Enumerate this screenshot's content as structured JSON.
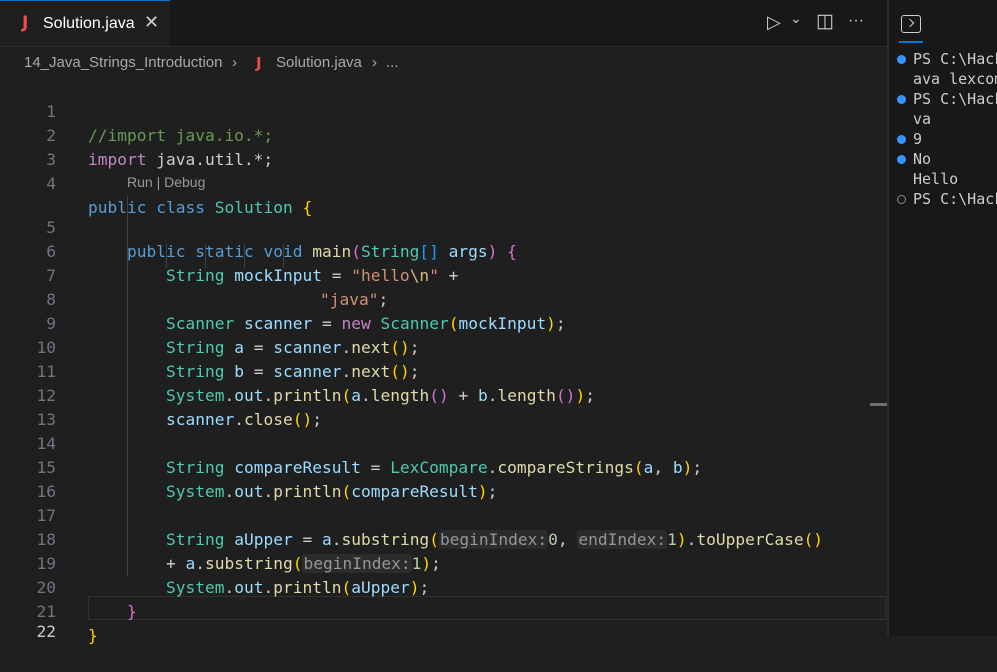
{
  "tab": {
    "title": "Solution.java",
    "close_glyph": "✕",
    "icon": "java-icon"
  },
  "actions": {
    "run_glyph": "▷",
    "chevron_glyph": "⌄",
    "split_glyph": "◫",
    "more_glyph": "···"
  },
  "breadcrumb": {
    "folder": "14_Java_Strings_Introduction",
    "file": "Solution.java",
    "more": "...",
    "sep": "›",
    "icon_glyph": "J"
  },
  "codelens": "Run | Debug",
  "code": {
    "1": {
      "num": "1",
      "t1": "//import java.io.*;"
    },
    "2": {
      "num": "2",
      "t1": "import",
      "t2": " java.util.*;"
    },
    "3": {
      "num": "3"
    },
    "4": {
      "num": "4",
      "t1": "public",
      "t2": " ",
      "t3": "class",
      "t4": " ",
      "t5": "Solution",
      "t6": " ",
      "t7": "{"
    },
    "5": {
      "num": "5",
      "t1": "public",
      "t2": " ",
      "t3": "static",
      "t4": " ",
      "t5": "void",
      "t6": " ",
      "t7": "main",
      "t8": "(",
      "t9": "String",
      "t10": "[]",
      "t11": " ",
      "t12": "args",
      "t13": ")",
      "t14": " ",
      "t15": "{"
    },
    "6": {
      "num": "6",
      "t1": "String",
      "t2": " ",
      "t3": "mockInput",
      "t4": " = ",
      "t5": "\"hello",
      "t6": "\\n",
      "t7": "\"",
      "t8": " +"
    },
    "7": {
      "num": "7",
      "t1": "\"java\"",
      "t2": ";"
    },
    "8": {
      "num": "8",
      "t1": "Scanner",
      "t2": " ",
      "t3": "scanner",
      "t4": " = ",
      "t5": "new",
      "t6": " ",
      "t7": "Scanner",
      "t8": "(",
      "t9": "mockInput",
      "t10": ")",
      "t11": ";"
    },
    "9": {
      "num": "9",
      "t1": "String",
      "t2": " ",
      "t3": "a",
      "t4": " = ",
      "t5": "scanner",
      "t6": ".",
      "t7": "next",
      "t8": "()",
      "t9": ";"
    },
    "10": {
      "num": "10",
      "t1": "String",
      "t2": " ",
      "t3": "b",
      "t4": " = ",
      "t5": "scanner",
      "t6": ".",
      "t7": "next",
      "t8": "()",
      "t9": ";"
    },
    "11": {
      "num": "11",
      "t1": "System",
      "t2": ".",
      "t3": "out",
      "t4": ".",
      "t5": "println",
      "t6": "(",
      "t7": "a",
      "t8": ".",
      "t9": "length",
      "t10": "()",
      "t11": " + ",
      "t12": "b",
      "t13": ".",
      "t14": "length",
      "t15": "()",
      "t16": ")",
      "t17": ";"
    },
    "12": {
      "num": "12",
      "t1": "scanner",
      "t2": ".",
      "t3": "close",
      "t4": "()",
      "t5": ";"
    },
    "13": {
      "num": "13"
    },
    "14": {
      "num": "14",
      "t1": "String",
      "t2": " ",
      "t3": "compareResult",
      "t4": " = ",
      "t5": "LexCompare",
      "t6": ".",
      "t7": "compareStrings",
      "t8": "(",
      "t9": "a",
      "t10": ", ",
      "t11": "b",
      "t12": ")",
      "t13": ";"
    },
    "15": {
      "num": "15",
      "t1": "System",
      "t2": ".",
      "t3": "out",
      "t4": ".",
      "t5": "println",
      "t6": "(",
      "t7": "compareResult",
      "t8": ")",
      "t9": ";"
    },
    "16": {
      "num": "16"
    },
    "17": {
      "num": "17",
      "t1": "String",
      "t2": " ",
      "t3": "aUpper",
      "t4": " = ",
      "t5": "a",
      "t6": ".",
      "t7": "substring",
      "t8": "(",
      "t9": "beginIndex:",
      "t10": "0",
      "t11": ", ",
      "t12": "endIndex:",
      "t13": "1",
      "t14": ")",
      "t15": ".",
      "t16": "toUpperCase",
      "t17": "()"
    },
    "18": {
      "num": "18",
      "t1": "+ ",
      "t2": "a",
      "t3": ".",
      "t4": "substring",
      "t5": "(",
      "t6": "beginIndex:",
      "t7": "1",
      "t8": ")",
      "t9": ";"
    },
    "19": {
      "num": "19",
      "t1": "System",
      "t2": ".",
      "t3": "out",
      "t4": ".",
      "t5": "println",
      "t6": "(",
      "t7": "aUpper",
      "t8": ")",
      "t9": ";"
    },
    "20": {
      "num": "20",
      "t1": "}"
    },
    "21": {
      "num": "21",
      "t1": "}"
    },
    "22": {
      "num": "22"
    }
  },
  "terminal": {
    "lines": [
      "PS C:\\Hack",
      "ava lexcom",
      "PS C:\\Hack",
      "va",
      "9",
      "No",
      "Hello",
      "PS C:\\Hack"
    ]
  }
}
